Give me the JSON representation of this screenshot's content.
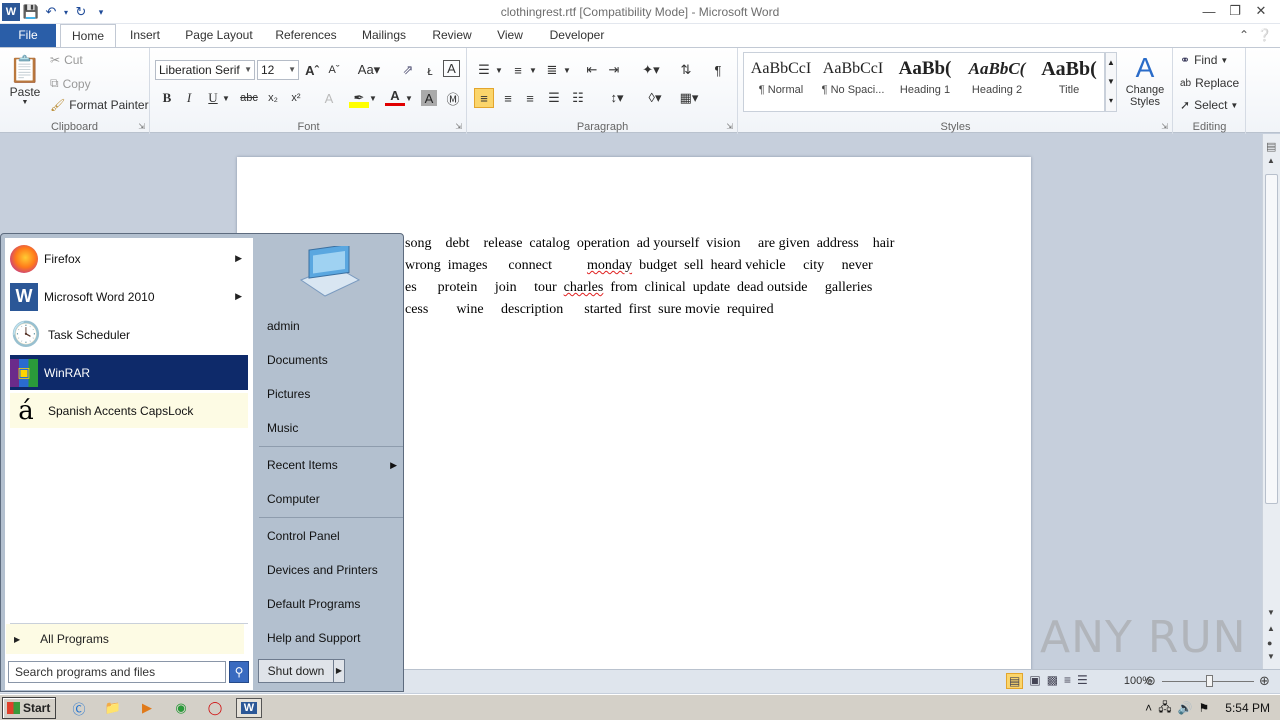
{
  "window": {
    "title": "clothingrest.rtf [Compatibility Mode] - Microsoft Word"
  },
  "tabs": [
    "File",
    "Home",
    "Insert",
    "Page Layout",
    "References",
    "Mailings",
    "Review",
    "View",
    "Developer"
  ],
  "ribbon": {
    "clipboard": {
      "paste": "Paste",
      "cut": "Cut",
      "copy": "Copy",
      "format_painter": "Format Painter",
      "label": "Clipboard"
    },
    "font": {
      "name": "Liberation Serif",
      "size": "12",
      "label": "Font"
    },
    "paragraph": {
      "label": "Paragraph"
    },
    "styles": {
      "label": "Styles",
      "items": [
        {
          "sample": "AaBbCcI",
          "name": "¶ Normal"
        },
        {
          "sample": "AaBbCcI",
          "name": "¶ No Spaci..."
        },
        {
          "sample": "AaBb(",
          "name": "Heading 1"
        },
        {
          "sample": "AaBbC(",
          "name": "Heading 2"
        },
        {
          "sample": "AaBb(",
          "name": "Title"
        }
      ],
      "change_styles": "Change Styles"
    },
    "editing": {
      "label": "Editing",
      "find": "Find",
      "replace": "Replace",
      "select": "Select"
    }
  },
  "document": {
    "lines": [
      "song    debt    release  catalog  operation  ad yourself  vision     are given  address    hair",
      "wrong  images      connect          monday  budget  sell  heard vehicle     city     never",
      "es      protein     join     tour  charles  from  clinical  update  dead outside     galleries",
      "cess        wine     description      started  first  sure movie  required"
    ]
  },
  "status": {
    "zoom": "100%"
  },
  "watermark": "ANY RUN",
  "start_menu": {
    "programs": [
      {
        "label": "Firefox",
        "icon": "firefox-icon",
        "has_sub": true
      },
      {
        "label": "Microsoft Word 2010",
        "icon": "word-icon",
        "has_sub": true
      },
      {
        "label": "Task Scheduler",
        "icon": "clock-icon",
        "has_sub": false
      },
      {
        "label": "WinRAR",
        "icon": "winrar-icon",
        "has_sub": false
      },
      {
        "label": "Spanish Accents CapsLock",
        "icon": "accent-a-icon",
        "has_sub": false
      }
    ],
    "all_programs": "All Programs",
    "search_placeholder": "Search programs and files",
    "right": {
      "user": "admin",
      "documents": "Documents",
      "pictures": "Pictures",
      "music": "Music",
      "recent": "Recent Items",
      "computer": "Computer",
      "control_panel": "Control Panel",
      "devices": "Devices and Printers",
      "defaults": "Default Programs",
      "help": "Help and Support"
    },
    "shutdown": "Shut down"
  },
  "taskbar": {
    "start": "Start",
    "time": "5:54 PM"
  }
}
